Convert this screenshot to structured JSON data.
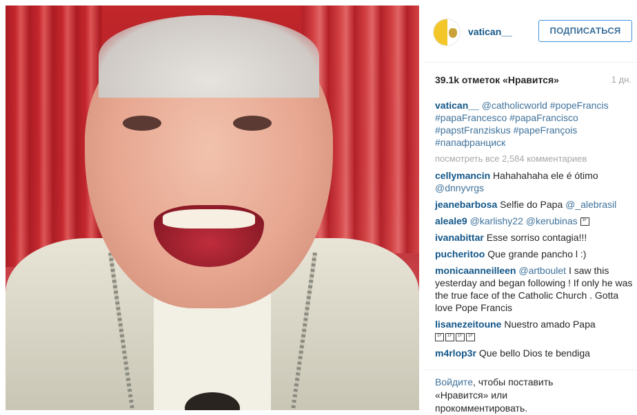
{
  "post": {
    "username": "vatican__",
    "follow_label": "ПОДПИСАТЬСЯ",
    "likes": "39.1k отметок «Нравится»",
    "time": "1 дн.",
    "caption": {
      "user": "vatican__",
      "text": "@catholicworld #popeFrancis #papaFrancesco #papaFrancisco #papstFranziskus #papeFrançois #папафранциск"
    },
    "view_all": "посмотреть все 2,584 комментариев"
  },
  "comments": [
    {
      "user": "cellymancin",
      "text": "Hahahahaha ele é ótimo",
      "mention": "@dnnyvrgs"
    },
    {
      "user": "jeanebarbosa",
      "text": "Selfie do Papa",
      "mention": "@_alebrasil"
    },
    {
      "user": "aleale9",
      "text": "",
      "mention": "@karlishy22 @kerubinas",
      "gif": "1F"
    },
    {
      "user": "ivanabittar",
      "text": "Esse sorriso contagia!!!",
      "mention": ""
    },
    {
      "user": "pucheritoo",
      "text": "Que grande pancho l :)",
      "mention": ""
    },
    {
      "user": "monicaanneilleen",
      "text": "I saw this yesterday and began following ! If only he was the true face of the Catholic Church . Gotta love Pope Francis",
      "mention": "@artboulet"
    },
    {
      "user": "lisanezeitoune",
      "text": "Nuestro amado Papa",
      "mention": ""
    },
    {
      "user": "m4rlop3r",
      "text": "Que bello Dios te bendiga",
      "mention": ""
    }
  ],
  "login": {
    "link": "Войдите",
    "rest1": ", чтобы поставить",
    "rest2": "«Нравится» или",
    "rest3": "прокомментировать."
  }
}
